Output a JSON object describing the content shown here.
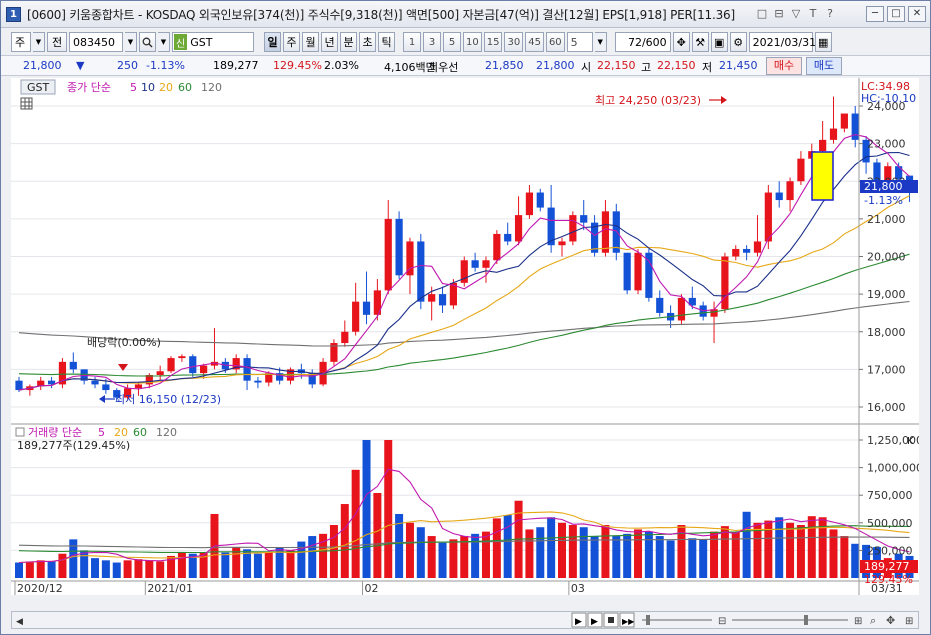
{
  "window": {
    "number": "1",
    "title": "[0600] 키움종합차트 - KOSDAQ 외국인보유[374(천)] 주식수[9,318(천)] 액면[500] 자본금[47(억)] 결산[12월] EPS[1,918] PER[11.36]",
    "tools": [
      "□",
      "⊟",
      "▽",
      "T",
      "?"
    ],
    "controls": [
      "─",
      "□",
      "✕"
    ]
  },
  "toolbar": {
    "type_value": "주",
    "range_value": "전",
    "code_value": "083450",
    "shin": "신",
    "stock_name": "GST",
    "periods": [
      "일",
      "주",
      "월",
      "년",
      "분",
      "초",
      "틱"
    ],
    "active_period": "일",
    "intervals": [
      "1",
      "3",
      "5",
      "10",
      "15",
      "30",
      "45",
      "60"
    ],
    "interval_value": "5",
    "count": "72/600",
    "date": "2021/03/31"
  },
  "quote": {
    "price": "21,800",
    "arrow": "▼",
    "change": "250",
    "change_rate": "-1.13%",
    "volume": "189,277",
    "volume_rate": "129.45%",
    "turnover": "2.03%",
    "amount": "4,106백만",
    "best_label": "최우선",
    "best_ask": "21,850",
    "best_bid": "21,800",
    "open_label": "시",
    "open": "22,150",
    "high_label": "고",
    "high": "22,150",
    "low_label": "저",
    "low": "21,450",
    "buy_label": "매수",
    "sell_label": "매도"
  },
  "price_panel": {
    "legend_code": "GST",
    "legend": "종가 단순",
    "ma_periods": [
      "5",
      "10",
      "20",
      "60",
      "120"
    ],
    "lc": "LC:34.98",
    "hc": "HC:-10.10",
    "current_price": "21,800",
    "current_rate": "-1.13%",
    "max_label": "최고 24,250 (03/23)",
    "min_label": "최저 16,150 (12/23)",
    "dividend_label": "배당락(0.00%)",
    "y_ticks": [
      "24,000",
      "23,000",
      "22,000",
      "21,000",
      "20,000",
      "19,000",
      "18,000",
      "17,000",
      "16,000"
    ]
  },
  "volume_panel": {
    "legend": "거래량 단순",
    "ma_periods": [
      "5",
      "20",
      "60",
      "120"
    ],
    "current_label": "189,277주(129.45%)",
    "current_value": "189,277",
    "current_rate": "129.45%",
    "y_ticks": [
      "1,250,000",
      "1,000,000",
      "750,000",
      "500,000",
      "250,000"
    ],
    "ticks_suffix": "K"
  },
  "x_axis": {
    "labels": [
      "2020/12",
      "2021/01",
      "02",
      "03"
    ],
    "right_label": "03/31"
  },
  "colors": {
    "up": "#e8141b",
    "down": "#1352d6",
    "ma5": "#c018b0",
    "ma10": "#1a2f8a",
    "ma20": "#e6a817",
    "ma60": "#2c8a32",
    "ma120": "#707070"
  },
  "chart_data": {
    "type": "candlestick",
    "candles": [
      [
        16700,
        16800,
        16400,
        16450
      ],
      [
        16450,
        16600,
        16300,
        16550
      ],
      [
        16550,
        16800,
        16450,
        16700
      ],
      [
        16700,
        16800,
        16500,
        16600
      ],
      [
        16600,
        17300,
        16500,
        17200
      ],
      [
        17200,
        17450,
        16900,
        17000
      ],
      [
        17000,
        17000,
        16600,
        16700
      ],
      [
        16700,
        16800,
        16500,
        16600
      ],
      [
        16600,
        16750,
        16350,
        16450
      ],
      [
        16450,
        16500,
        16150,
        16250
      ],
      [
        16250,
        16600,
        16200,
        16500
      ],
      [
        16500,
        16650,
        16300,
        16600
      ],
      [
        16600,
        16900,
        16500,
        16850
      ],
      [
        16850,
        17100,
        16700,
        16950
      ],
      [
        16950,
        17350,
        16900,
        17300
      ],
      [
        17300,
        17400,
        17200,
        17350
      ],
      [
        17350,
        17400,
        16800,
        16900
      ],
      [
        16900,
        17150,
        16750,
        17100
      ],
      [
        17100,
        18100,
        17000,
        17200
      ],
      [
        17200,
        17300,
        16900,
        17000
      ],
      [
        17000,
        17400,
        16900,
        17300
      ],
      [
        17300,
        17400,
        16450,
        16700
      ],
      [
        16700,
        16800,
        16500,
        16650
      ],
      [
        16650,
        16950,
        16550,
        16900
      ],
      [
        16900,
        17050,
        16600,
        16700
      ],
      [
        16700,
        17050,
        16600,
        17000
      ],
      [
        17000,
        17150,
        16750,
        16900
      ],
      [
        16900,
        17000,
        16500,
        16600
      ],
      [
        16600,
        17300,
        16550,
        17200
      ],
      [
        17200,
        17800,
        17100,
        17700
      ],
      [
        17700,
        18300,
        17600,
        18000
      ],
      [
        18000,
        19300,
        17900,
        18800
      ],
      [
        18800,
        19600,
        18200,
        18450
      ],
      [
        18450,
        19400,
        18300,
        19100
      ],
      [
        19100,
        21500,
        19000,
        21000
      ],
      [
        21000,
        21200,
        19400,
        19500
      ],
      [
        19500,
        20500,
        19000,
        20400
      ],
      [
        20400,
        20600,
        18600,
        18800
      ],
      [
        18800,
        19200,
        18300,
        19000
      ],
      [
        19000,
        19200,
        18500,
        18700
      ],
      [
        18700,
        19400,
        18600,
        19300
      ],
      [
        19300,
        20000,
        19200,
        19900
      ],
      [
        19900,
        20100,
        19600,
        19700
      ],
      [
        19700,
        20000,
        19300,
        19900
      ],
      [
        19900,
        20700,
        19800,
        20600
      ],
      [
        20600,
        20900,
        20300,
        20400
      ],
      [
        20400,
        21600,
        20300,
        21100
      ],
      [
        21100,
        21900,
        21000,
        21700
      ],
      [
        21700,
        21800,
        21200,
        21300
      ],
      [
        21300,
        21900,
        20100,
        20300
      ],
      [
        20300,
        20500,
        20000,
        20400
      ],
      [
        20400,
        21200,
        20300,
        21100
      ],
      [
        21100,
        21500,
        20700,
        20900
      ],
      [
        20900,
        21100,
        20000,
        20100
      ],
      [
        20100,
        21500,
        20000,
        21200
      ],
      [
        21200,
        21400,
        19900,
        20100
      ],
      [
        20100,
        20100,
        19000,
        19100
      ],
      [
        19100,
        20200,
        19000,
        20100
      ],
      [
        20100,
        20200,
        18800,
        18900
      ],
      [
        18900,
        19100,
        18400,
        18500
      ],
      [
        18500,
        18700,
        18100,
        18300
      ],
      [
        18300,
        19000,
        18200,
        18900
      ],
      [
        18900,
        19200,
        18600,
        18700
      ],
      [
        18700,
        18800,
        18300,
        18400
      ],
      [
        18400,
        18800,
        17700,
        18600
      ],
      [
        18600,
        20100,
        18500,
        20000
      ],
      [
        20000,
        20300,
        19900,
        20200
      ],
      [
        20200,
        20300,
        19900,
        20100
      ],
      [
        20100,
        21100,
        20000,
        20400
      ],
      [
        20400,
        21900,
        20200,
        21700
      ],
      [
        21700,
        22000,
        21300,
        21500
      ],
      [
        21500,
        22100,
        21200,
        22000
      ],
      [
        22000,
        22800,
        21900,
        22600
      ],
      [
        22600,
        23000,
        22100,
        22800
      ],
      [
        22800,
        23600,
        22600,
        23100
      ],
      [
        23100,
        24250,
        23000,
        23400
      ],
      [
        23400,
        23800,
        23300,
        23800
      ],
      [
        23800,
        24000,
        22900,
        23100
      ],
      [
        23100,
        23200,
        22200,
        22500
      ],
      [
        22500,
        22600,
        21800,
        21900
      ],
      [
        21900,
        22500,
        21800,
        22400
      ],
      [
        22400,
        22500,
        21900,
        22050
      ],
      [
        22150,
        22150,
        21450,
        21800
      ]
    ],
    "volumes": [
      14,
      15,
      16,
      15,
      22,
      35,
      25,
      18,
      16,
      14,
      16,
      17,
      16,
      15,
      20,
      23,
      22,
      23,
      58,
      23,
      28,
      26,
      22,
      24,
      28,
      25,
      33,
      38,
      40,
      48,
      67,
      98,
      125,
      77,
      125,
      58,
      50,
      46,
      38,
      32,
      35,
      38,
      40,
      42,
      54,
      57,
      70,
      44,
      46,
      55,
      50,
      48,
      46,
      38,
      48,
      38,
      40,
      44,
      42,
      38,
      34,
      48,
      36,
      35,
      42,
      47,
      42,
      60,
      50,
      52,
      55,
      50,
      48,
      56,
      55,
      44,
      38,
      31,
      30,
      28,
      18,
      22,
      20
    ]
  }
}
